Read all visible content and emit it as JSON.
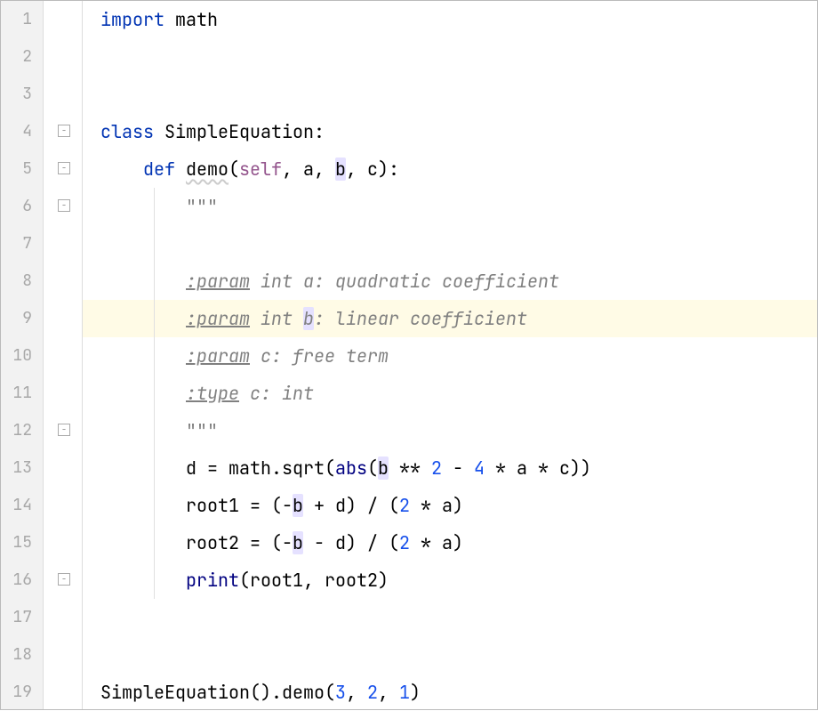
{
  "editor": {
    "lineNumbers": [
      "1",
      "2",
      "3",
      "4",
      "5",
      "6",
      "7",
      "8",
      "9",
      "10",
      "11",
      "12",
      "13",
      "14",
      "15",
      "16",
      "17",
      "18",
      "19"
    ],
    "highlightedLine": 9,
    "foldMarkers": [
      4,
      5,
      6,
      12,
      16
    ],
    "lines": {
      "l1": {
        "import": "import",
        "sp": " ",
        "mod": "math"
      },
      "l4": {
        "kw": "class",
        "sp": " ",
        "name": "SimpleEquation:"
      },
      "l5": {
        "indent": "    ",
        "kw": "def",
        "sp": " ",
        "name": "demo",
        "lp": "(",
        "self": "self",
        "c1": ", a, ",
        "b": "b",
        "c2": ", c):"
      },
      "l6": {
        "indent": "        ",
        "q": "\"\"\""
      },
      "l8": {
        "indent": "        ",
        "tag": ":param",
        "rest": " int a: quadratic coefficient"
      },
      "l9": {
        "indent": "        ",
        "tag": ":param",
        "pre": " int ",
        "b": "b",
        "rest": ": linear coefficient"
      },
      "l10": {
        "indent": "        ",
        "tag": ":param",
        "rest": " c: free term"
      },
      "l11": {
        "indent": "        ",
        "tag": ":type",
        "rest": " c: int"
      },
      "l12": {
        "indent": "        ",
        "q": "\"\"\""
      },
      "l13": {
        "indent": "        ",
        "p1": "d = math.sqrt(",
        "abs": "abs",
        "p2": "(",
        "b": "b",
        "p3": " ** ",
        "n2": "2",
        "p4": " - ",
        "n4": "4",
        "p5": " * a * c))"
      },
      "l14": {
        "indent": "        ",
        "p1": "root1 = (-",
        "b": "b",
        "p2": " + d) / (",
        "n2": "2",
        "p3": " * a)"
      },
      "l15": {
        "indent": "        ",
        "p1": "root2 = (-",
        "b": "b",
        "p2": " - d) / (",
        "n2": "2",
        "p3": " * a)"
      },
      "l16": {
        "indent": "        ",
        "print": "print",
        "rest": "(root1, root2)"
      },
      "l19": {
        "p1": "SimpleEquation().demo(",
        "n3": "3",
        "c1": ", ",
        "n2": "2",
        "c2": ", ",
        "n1": "1",
        "p2": ")"
      }
    }
  }
}
